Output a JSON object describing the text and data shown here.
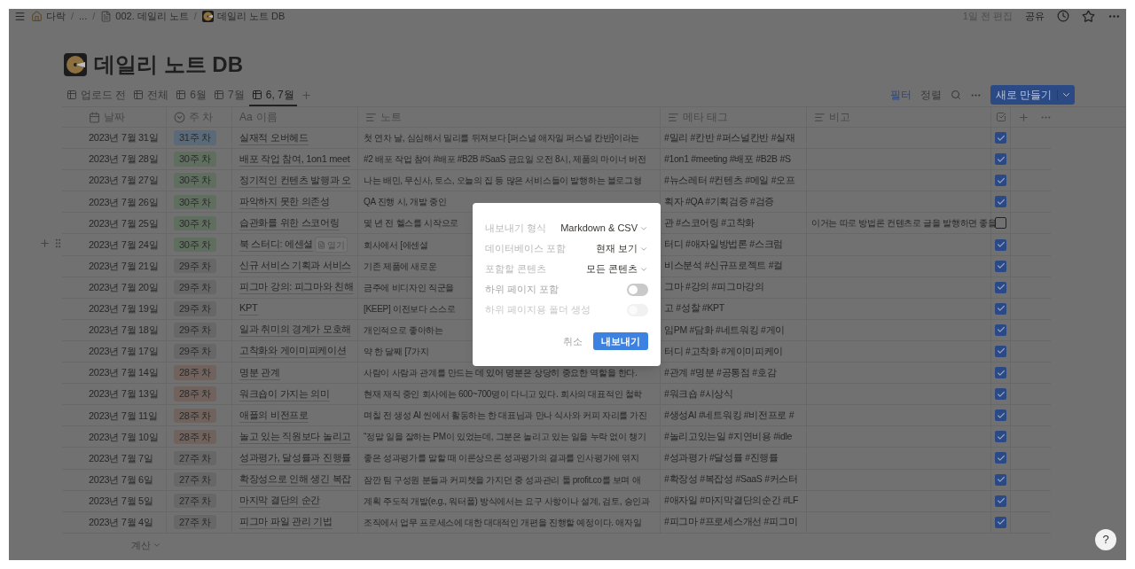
{
  "breadcrumb": [
    {
      "kind": "house",
      "label": "다락"
    },
    {
      "kind": "plain",
      "label": "..."
    },
    {
      "kind": "page",
      "label": "002. 데일리 노트"
    },
    {
      "kind": "db",
      "label": "데일리 노트 DB"
    }
  ],
  "breadcrumb_separator": "/",
  "topbar": {
    "edited": "1일 전 편집",
    "share": "공유"
  },
  "title": "데일리 노트 DB",
  "views": [
    {
      "label": "업로드 전",
      "selected": false
    },
    {
      "label": "전체",
      "selected": false
    },
    {
      "label": "6월",
      "selected": false
    },
    {
      "label": "7월",
      "selected": false
    },
    {
      "label": "6, 7월",
      "selected": true
    }
  ],
  "toolbar": {
    "filter": "필터",
    "sort": "정렬",
    "new": "새로 만들기"
  },
  "columns": [
    {
      "kind": "date",
      "label": "날짜"
    },
    {
      "kind": "select",
      "label": "주 차"
    },
    {
      "kind": "title",
      "icon_text": "Aa",
      "label": "이름"
    },
    {
      "kind": "text",
      "label": "노트"
    },
    {
      "kind": "text",
      "label": "메타 태그"
    },
    {
      "kind": "text",
      "label": "비고"
    }
  ],
  "row_action": "열기",
  "rows": [
    {
      "date": "2023년 7월 31일",
      "week": "31주 차",
      "color": "#5b6a78",
      "name": "실재적 오버헤드",
      "note": "첫 연차 날, 심심해서 밀리를 뒤져보다 [퍼스널 애자일 퍼스널 칸반]이라는",
      "tags": "#밀리 #칸반 #퍼스널칸반 #실재",
      "checked": true,
      "hovered": false
    },
    {
      "date": "2023년 7월 28일",
      "week": "30주 차",
      "color": "#5f6e5f",
      "name": "배포 작업 참여, 1on1 meet",
      "note": "#2 배포 작업 참여 #배포 #B2B #SaaS 금요일 오전 8시, 제품의 마이너 버전",
      "tags": "#1on1 #meeting #배포 #B2B #S",
      "checked": true,
      "hovered": false
    },
    {
      "date": "2023년 7월 27일",
      "week": "30주 차",
      "color": "#5f6e5f",
      "name": "정기적인 컨텐츠 발행과 오",
      "note": "나는 배민, 무신사, 토스, 오늘의 집 등 많은 서비스들이 발행하는 블로그형",
      "tags": "#뉴스레터 #컨텐츠 #메일 #오프",
      "checked": true,
      "hovered": false
    },
    {
      "date": "2023년 7월 26일",
      "week": "30주 차",
      "color": "#5f6e5f",
      "name": "파악하지 못한 의존성",
      "note": "QA 진행 시, 개발 중인",
      "tags": "획자 #QA #기획검증 #검증",
      "checked": true,
      "hovered": false
    },
    {
      "date": "2023년 7월 25일",
      "week": "30주 차",
      "color": "#5f6e5f",
      "name": "습관화를 위한 스코어링",
      "note": "몇 년 전 헬스를 시작으로",
      "tags": "관 #스코어링 #고착화",
      "remark": "이거는 따로 방법론 컨텐츠로 글을 발행하면 좋을",
      "checked": false,
      "hovered": false
    },
    {
      "date": "2023년 7월 24일",
      "week": "30주 차",
      "color": "#5f6e5f",
      "name": "북 스터디: 에센셜",
      "note": "회사에서 [에센셜",
      "tags": "터디 #애자일방법론 #스크럼",
      "checked": true,
      "hovered": true
    },
    {
      "date": "2023년 7월 21일",
      "week": "29주 차",
      "color": "#676767",
      "name": "신규 서비스 기획과 서비스",
      "note": "기존 제품에 새로운",
      "tags": "비스분석 #신규프로젝트 #컬",
      "checked": true,
      "hovered": false
    },
    {
      "date": "2023년 7월 20일",
      "week": "29주 차",
      "color": "#676767",
      "name": "피그마 강의: 피그마와 친해",
      "note": "금주에 비디자인 직군을",
      "tags": "그마 #강의 #피그마강의",
      "checked": true,
      "hovered": false
    },
    {
      "date": "2023년 7월 19일",
      "week": "29주 차",
      "color": "#676767",
      "name": "KPT",
      "note": "[KEEP] 이전보다 스스로",
      "tags": "고 #성찰 #KPT",
      "checked": true,
      "hovered": false
    },
    {
      "date": "2023년 7월 18일",
      "week": "29주 차",
      "color": "#676767",
      "name": "일과 취미의 경계가 모호해",
      "note": "개인적으로 좋아하는",
      "tags": "임PM #담화 #네트워킹 #게이",
      "checked": true,
      "hovered": false
    },
    {
      "date": "2023년 7월 17일",
      "week": "29주 차",
      "color": "#676767",
      "name": "고착화와 게이미피케이션",
      "note": "약 한 달째 [7가지",
      "tags": "터디 #고착화 #게이미피케이",
      "checked": true,
      "hovered": false
    },
    {
      "date": "2023년 7월 14일",
      "week": "28주 차",
      "color": "#70635d",
      "name": "명분 관계",
      "note": "사람이 사람과 관계를 만드는 데 있어 명분은 상당히 중요한 역할을 한다.",
      "tags": "#관계 #명분 #공통점 #호감",
      "checked": true,
      "hovered": false
    },
    {
      "date": "2023년 7월 13일",
      "week": "28주 차",
      "color": "#70635d",
      "name": "워크숍이 가지는 의미",
      "note": "현재 재직 중인 회사에는 600~700명이 다니고 있다. 회사의 대표적인 철학",
      "tags": "#워크숍 #시상식",
      "checked": true,
      "hovered": false
    },
    {
      "date": "2023년 7월 11일",
      "week": "28주 차",
      "color": "#70635d",
      "name": "애플의 비전프로",
      "note": "며칠 전 생성 AI 씬에서 활동하는 한 대표님과 만나 식사와 커피 자리를 가진",
      "tags": "#생성AI #네트워킹 #비전프로 #",
      "checked": true,
      "hovered": false
    },
    {
      "date": "2023년 7월 10일",
      "week": "28주 차",
      "color": "#70635d",
      "name": "놀고 있는 직원보다 놀리고",
      "note": "“정말 일을 잘하는 PM이 있었는데, 그분은 놀리고 있는 일을 누락 없이 챙기",
      "tags": "#놀리고있는일 #지연비용 #idle",
      "checked": true,
      "hovered": false
    },
    {
      "date": "2023년 7월 7일",
      "week": "27주 차",
      "color": "#676767",
      "name": "성과평가, 달성률과 진행률",
      "note": "좋은 성과평가를 말할 때 이론상으론 성과평가의 결과를 인사평가에 엮지",
      "tags": "#성과평가 #달성률 #진행률",
      "checked": true,
      "hovered": false
    },
    {
      "date": "2023년 7월 6일",
      "week": "27주 차",
      "color": "#676767",
      "name": "확장성으로 인해 생긴 복잡",
      "note": "잠깐 팀 구성원 분들과 커피챗을 가지던 중 성과관리 툴 profit.co를 보며 애",
      "tags": "#확장성 #복잡성 #SaaS #커스터",
      "checked": true,
      "hovered": false
    },
    {
      "date": "2023년 7월 5일",
      "week": "27주 차",
      "color": "#676767",
      "name": "마지막 결단의 순간",
      "note": "계획 주도적 개발(e.g., 워터폴) 방식에서는 요구 사항이나 설계, 검토, 승인과",
      "tags": "#애자일 #마지막결단의순간 #LF",
      "checked": true,
      "hovered": false
    },
    {
      "date": "2023년 7월 4일",
      "week": "27주 차",
      "color": "#676767",
      "name": "피그마 파일 관리 기법",
      "note": "조직에서 업무 프로세스에 대한 대대적인 개편을 진행할 예정이다. 애자일",
      "tags": "#피그마 #프로세스개선 #피그미",
      "checked": true,
      "hovered": false
    }
  ],
  "footer": "계산",
  "help": "?",
  "dialog": {
    "options": [
      {
        "kind": "select",
        "label": "내보내기 형식",
        "value": "Markdown & CSV"
      },
      {
        "kind": "select",
        "label": "데이터베이스 포함",
        "value": "현재 보기"
      },
      {
        "kind": "select",
        "label": "포함할 콘텐츠",
        "value": "모든 콘텐츠"
      },
      {
        "kind": "toggle",
        "label": "하위 페이지 포함",
        "on": false,
        "disabled": false
      },
      {
        "kind": "toggle",
        "label": "하위 페이지용 폴더 생성",
        "on": false,
        "disabled": true
      }
    ],
    "cancel": "취소",
    "confirm": "내보내기"
  }
}
